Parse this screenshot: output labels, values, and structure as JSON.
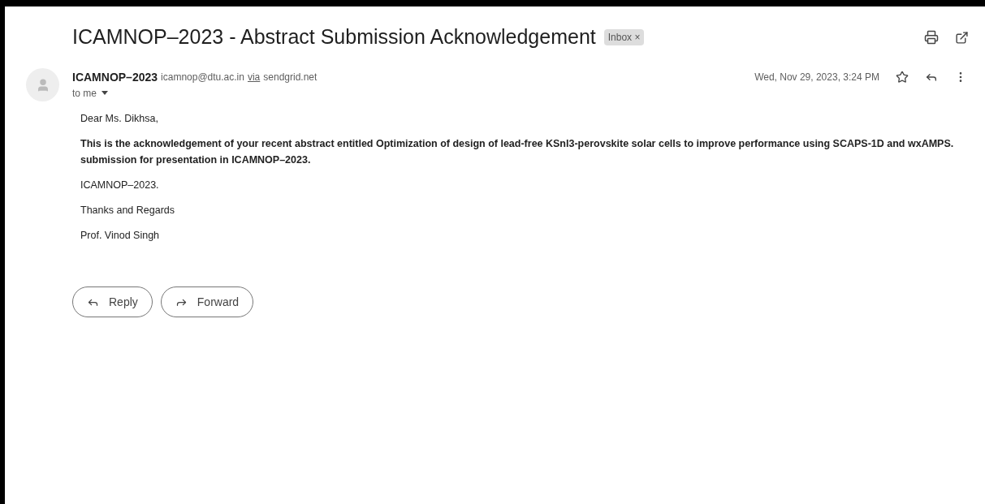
{
  "subject": "ICAMNOP–2023 - Abstract Submission Acknowledgement",
  "label": {
    "text": "Inbox",
    "remove": "×"
  },
  "sender": {
    "name": "ICAMNOP–2023",
    "email": "icamnop@dtu.ac.in",
    "via": "via",
    "relay": "sendgrid.net",
    "recipient": "to me"
  },
  "date": "Wed, Nov 29, 2023, 3:24 PM",
  "starred": false,
  "body": [
    {
      "kind": "plain",
      "text": "Dear Ms. Dikhsa,"
    },
    {
      "kind": "bold",
      "text": "This is the acknowledgement of your recent abstract entitled Optimization of design of lead-free KSnl3-perovskite solar cells to improve performance using SCAPS-1D and wxAMPS. submission for presentation in ICAMNOP–2023."
    },
    {
      "kind": "plain",
      "text": "ICAMNOP–2023."
    },
    {
      "kind": "plain",
      "text": "Thanks and Regards"
    },
    {
      "kind": "plain",
      "text": "Prof. Vinod Singh"
    }
  ],
  "actions": [
    "Reply",
    "Forward"
  ]
}
